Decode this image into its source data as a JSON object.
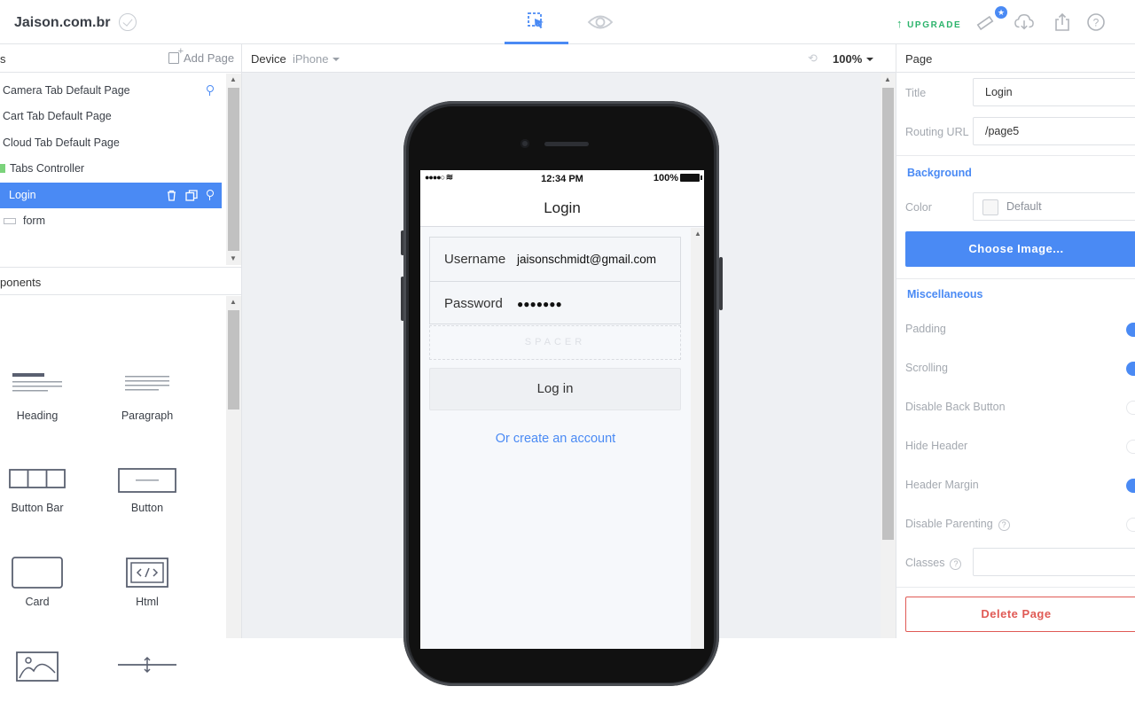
{
  "app": {
    "brand": "Jaison.com.br",
    "upgrade_label": "UPGRADE",
    "colors": {
      "accent": "#4a8af4",
      "upgrade": "#2bb36b",
      "danger": "#e05a55"
    }
  },
  "left_panel": {
    "pages_header": "s",
    "add_page_label": "Add Page",
    "pages": [
      {
        "label": "Camera Tab Default Page",
        "pinned": true
      },
      {
        "label": "Cart Tab Default Page"
      },
      {
        "label": "Cloud Tab Default Page"
      },
      {
        "label": "Tabs Controller"
      },
      {
        "label": "Login",
        "selected": true
      },
      {
        "label": "form"
      }
    ],
    "components_header": "ponents",
    "components": [
      "Heading",
      "Paragraph",
      "Button Bar",
      "Button",
      "Card",
      "Html"
    ]
  },
  "center": {
    "device_label": "Device",
    "device_value": "iPhone",
    "zoom": "100%",
    "phone": {
      "status_time": "12:34 PM",
      "status_signal": "●●●●○",
      "status_battery": "100%",
      "nav_title": "Login",
      "username_label": "Username",
      "username_value": "jaisonschmidt@gmail.com",
      "password_label": "Password",
      "password_value": "●●●●●●●",
      "spacer_label": "SPACER",
      "login_button": "Log in",
      "create_account_link": "Or create an account"
    }
  },
  "right_panel": {
    "header": "Page",
    "title_label": "Title",
    "title_value": "Login",
    "routing_label": "Routing URL",
    "routing_value": "/page5",
    "background_section": "Background",
    "color_label": "Color",
    "color_value": "Default",
    "choose_image_button": "Choose Image...",
    "misc_section": "Miscellaneous",
    "options": [
      {
        "label": "Padding",
        "on": true
      },
      {
        "label": "Scrolling",
        "on": true
      },
      {
        "label": "Disable Back Button",
        "on": false
      },
      {
        "label": "Hide Header",
        "on": false
      },
      {
        "label": "Header Margin",
        "on": true
      },
      {
        "label": "Disable Parenting",
        "on": false,
        "help": "?"
      }
    ],
    "classes_label": "Classes",
    "classes_help": "?",
    "delete_button": "Delete Page"
  }
}
